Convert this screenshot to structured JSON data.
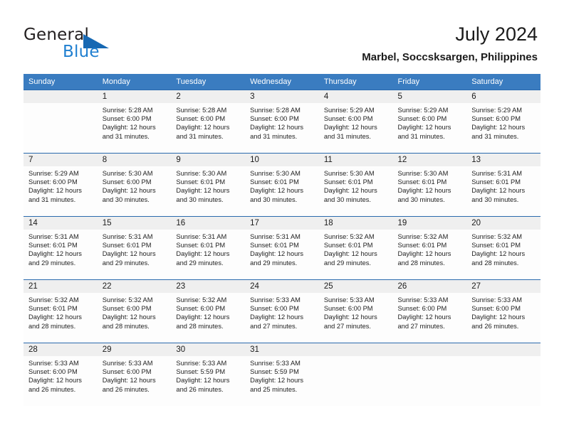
{
  "brand": {
    "word_one": "General",
    "word_two": "Blue",
    "flag_icon": "triangle-flag-icon",
    "color_dark": "#231f20",
    "color_blue": "#1f7fd0"
  },
  "header": {
    "title": "July 2024",
    "subtitle": "Marbel, Soccsksargen, Philippines"
  },
  "theme": {
    "header_bg": "#3a7cc0",
    "row_divider": "#2a6aad",
    "date_band": "#efefef",
    "cell_bg": "#fdfdfd",
    "text": "#1b1b1b"
  },
  "weekday_headers": [
    "Sunday",
    "Monday",
    "Tuesday",
    "Wednesday",
    "Thursday",
    "Friday",
    "Saturday"
  ],
  "labels": {
    "sunrise_prefix": "Sunrise:",
    "sunset_prefix": "Sunset:",
    "daylight_prefix": "Daylight:"
  },
  "weeks": [
    [
      {
        "date": "",
        "sunrise": "",
        "sunset": "",
        "daylight_line1": "",
        "daylight_line2": ""
      },
      {
        "date": "1",
        "sunrise": "Sunrise: 5:28 AM",
        "sunset": "Sunset: 6:00 PM",
        "daylight_line1": "Daylight: 12 hours",
        "daylight_line2": "and 31 minutes."
      },
      {
        "date": "2",
        "sunrise": "Sunrise: 5:28 AM",
        "sunset": "Sunset: 6:00 PM",
        "daylight_line1": "Daylight: 12 hours",
        "daylight_line2": "and 31 minutes."
      },
      {
        "date": "3",
        "sunrise": "Sunrise: 5:28 AM",
        "sunset": "Sunset: 6:00 PM",
        "daylight_line1": "Daylight: 12 hours",
        "daylight_line2": "and 31 minutes."
      },
      {
        "date": "4",
        "sunrise": "Sunrise: 5:29 AM",
        "sunset": "Sunset: 6:00 PM",
        "daylight_line1": "Daylight: 12 hours",
        "daylight_line2": "and 31 minutes."
      },
      {
        "date": "5",
        "sunrise": "Sunrise: 5:29 AM",
        "sunset": "Sunset: 6:00 PM",
        "daylight_line1": "Daylight: 12 hours",
        "daylight_line2": "and 31 minutes."
      },
      {
        "date": "6",
        "sunrise": "Sunrise: 5:29 AM",
        "sunset": "Sunset: 6:00 PM",
        "daylight_line1": "Daylight: 12 hours",
        "daylight_line2": "and 31 minutes."
      }
    ],
    [
      {
        "date": "7",
        "sunrise": "Sunrise: 5:29 AM",
        "sunset": "Sunset: 6:00 PM",
        "daylight_line1": "Daylight: 12 hours",
        "daylight_line2": "and 31 minutes."
      },
      {
        "date": "8",
        "sunrise": "Sunrise: 5:30 AM",
        "sunset": "Sunset: 6:00 PM",
        "daylight_line1": "Daylight: 12 hours",
        "daylight_line2": "and 30 minutes."
      },
      {
        "date": "9",
        "sunrise": "Sunrise: 5:30 AM",
        "sunset": "Sunset: 6:01 PM",
        "daylight_line1": "Daylight: 12 hours",
        "daylight_line2": "and 30 minutes."
      },
      {
        "date": "10",
        "sunrise": "Sunrise: 5:30 AM",
        "sunset": "Sunset: 6:01 PM",
        "daylight_line1": "Daylight: 12 hours",
        "daylight_line2": "and 30 minutes."
      },
      {
        "date": "11",
        "sunrise": "Sunrise: 5:30 AM",
        "sunset": "Sunset: 6:01 PM",
        "daylight_line1": "Daylight: 12 hours",
        "daylight_line2": "and 30 minutes."
      },
      {
        "date": "12",
        "sunrise": "Sunrise: 5:30 AM",
        "sunset": "Sunset: 6:01 PM",
        "daylight_line1": "Daylight: 12 hours",
        "daylight_line2": "and 30 minutes."
      },
      {
        "date": "13",
        "sunrise": "Sunrise: 5:31 AM",
        "sunset": "Sunset: 6:01 PM",
        "daylight_line1": "Daylight: 12 hours",
        "daylight_line2": "and 30 minutes."
      }
    ],
    [
      {
        "date": "14",
        "sunrise": "Sunrise: 5:31 AM",
        "sunset": "Sunset: 6:01 PM",
        "daylight_line1": "Daylight: 12 hours",
        "daylight_line2": "and 29 minutes."
      },
      {
        "date": "15",
        "sunrise": "Sunrise: 5:31 AM",
        "sunset": "Sunset: 6:01 PM",
        "daylight_line1": "Daylight: 12 hours",
        "daylight_line2": "and 29 minutes."
      },
      {
        "date": "16",
        "sunrise": "Sunrise: 5:31 AM",
        "sunset": "Sunset: 6:01 PM",
        "daylight_line1": "Daylight: 12 hours",
        "daylight_line2": "and 29 minutes."
      },
      {
        "date": "17",
        "sunrise": "Sunrise: 5:31 AM",
        "sunset": "Sunset: 6:01 PM",
        "daylight_line1": "Daylight: 12 hours",
        "daylight_line2": "and 29 minutes."
      },
      {
        "date": "18",
        "sunrise": "Sunrise: 5:32 AM",
        "sunset": "Sunset: 6:01 PM",
        "daylight_line1": "Daylight: 12 hours",
        "daylight_line2": "and 29 minutes."
      },
      {
        "date": "19",
        "sunrise": "Sunrise: 5:32 AM",
        "sunset": "Sunset: 6:01 PM",
        "daylight_line1": "Daylight: 12 hours",
        "daylight_line2": "and 28 minutes."
      },
      {
        "date": "20",
        "sunrise": "Sunrise: 5:32 AM",
        "sunset": "Sunset: 6:01 PM",
        "daylight_line1": "Daylight: 12 hours",
        "daylight_line2": "and 28 minutes."
      }
    ],
    [
      {
        "date": "21",
        "sunrise": "Sunrise: 5:32 AM",
        "sunset": "Sunset: 6:01 PM",
        "daylight_line1": "Daylight: 12 hours",
        "daylight_line2": "and 28 minutes."
      },
      {
        "date": "22",
        "sunrise": "Sunrise: 5:32 AM",
        "sunset": "Sunset: 6:00 PM",
        "daylight_line1": "Daylight: 12 hours",
        "daylight_line2": "and 28 minutes."
      },
      {
        "date": "23",
        "sunrise": "Sunrise: 5:32 AM",
        "sunset": "Sunset: 6:00 PM",
        "daylight_line1": "Daylight: 12 hours",
        "daylight_line2": "and 28 minutes."
      },
      {
        "date": "24",
        "sunrise": "Sunrise: 5:33 AM",
        "sunset": "Sunset: 6:00 PM",
        "daylight_line1": "Daylight: 12 hours",
        "daylight_line2": "and 27 minutes."
      },
      {
        "date": "25",
        "sunrise": "Sunrise: 5:33 AM",
        "sunset": "Sunset: 6:00 PM",
        "daylight_line1": "Daylight: 12 hours",
        "daylight_line2": "and 27 minutes."
      },
      {
        "date": "26",
        "sunrise": "Sunrise: 5:33 AM",
        "sunset": "Sunset: 6:00 PM",
        "daylight_line1": "Daylight: 12 hours",
        "daylight_line2": "and 27 minutes."
      },
      {
        "date": "27",
        "sunrise": "Sunrise: 5:33 AM",
        "sunset": "Sunset: 6:00 PM",
        "daylight_line1": "Daylight: 12 hours",
        "daylight_line2": "and 26 minutes."
      }
    ],
    [
      {
        "date": "28",
        "sunrise": "Sunrise: 5:33 AM",
        "sunset": "Sunset: 6:00 PM",
        "daylight_line1": "Daylight: 12 hours",
        "daylight_line2": "and 26 minutes."
      },
      {
        "date": "29",
        "sunrise": "Sunrise: 5:33 AM",
        "sunset": "Sunset: 6:00 PM",
        "daylight_line1": "Daylight: 12 hours",
        "daylight_line2": "and 26 minutes."
      },
      {
        "date": "30",
        "sunrise": "Sunrise: 5:33 AM",
        "sunset": "Sunset: 5:59 PM",
        "daylight_line1": "Daylight: 12 hours",
        "daylight_line2": "and 26 minutes."
      },
      {
        "date": "31",
        "sunrise": "Sunrise: 5:33 AM",
        "sunset": "Sunset: 5:59 PM",
        "daylight_line1": "Daylight: 12 hours",
        "daylight_line2": "and 25 minutes."
      },
      {
        "date": "",
        "sunrise": "",
        "sunset": "",
        "daylight_line1": "",
        "daylight_line2": ""
      },
      {
        "date": "",
        "sunrise": "",
        "sunset": "",
        "daylight_line1": "",
        "daylight_line2": ""
      },
      {
        "date": "",
        "sunrise": "",
        "sunset": "",
        "daylight_line1": "",
        "daylight_line2": ""
      }
    ]
  ]
}
